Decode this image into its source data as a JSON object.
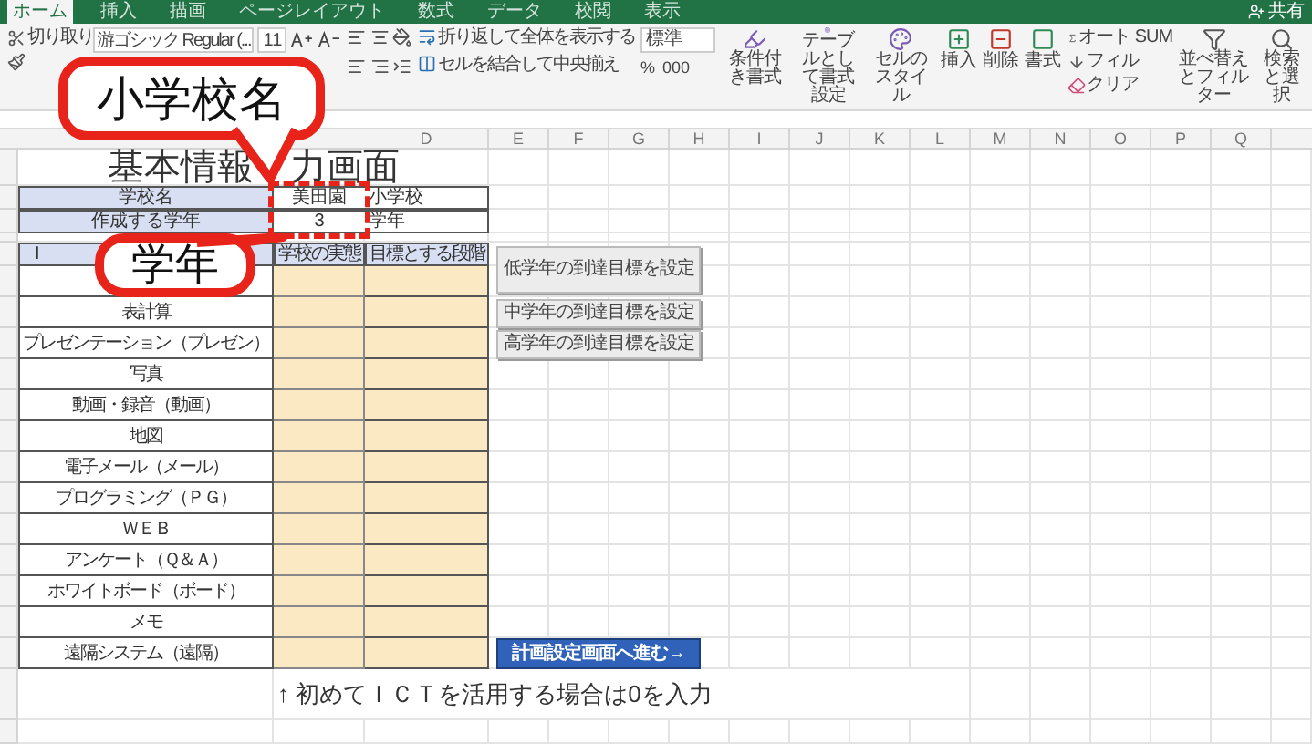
{
  "tabs": [
    {
      "label": "ホーム",
      "selected": true
    },
    {
      "label": "挿入",
      "selected": false
    },
    {
      "label": "描画",
      "selected": false
    },
    {
      "label": "ページレイアウト",
      "selected": false
    },
    {
      "label": "数式",
      "selected": false
    },
    {
      "label": "データ",
      "selected": false
    },
    {
      "label": "校閲",
      "selected": false
    },
    {
      "label": "表示",
      "selected": false
    }
  ],
  "share": "共有",
  "ribbon": {
    "cut": "切り取り",
    "font": "游ゴシック Regular (...",
    "size": "11",
    "wrap": "折り返して全体を表示する",
    "merge": "セルを結合して中央揃え",
    "number_format": "標準",
    "number_buttons": [
      "%",
      "000"
    ],
    "styles": [
      "条件付き書式",
      "テーブルとして書式設定",
      "セルのスタイル"
    ],
    "cells": [
      "挿入",
      "削除",
      "書式"
    ],
    "editing": [
      "オート SUM",
      "フィル",
      "クリア"
    ],
    "sort": "並べ替えとフィルター",
    "find": "検索と選択"
  },
  "columns": [
    "D",
    "E",
    "F",
    "G",
    "H",
    "I",
    "J",
    "K",
    "L",
    "M",
    "N",
    "O",
    "P",
    "Q"
  ],
  "sheet": {
    "title_parts": [
      "基本情報",
      "力画面"
    ],
    "info": [
      {
        "label": "学校名",
        "value": "美田園",
        "suffix": "小学校"
      },
      {
        "label": "作成する学年",
        "value": "3",
        "suffix": "学年"
      }
    ],
    "header": [
      "I",
      "学校の実態",
      "目標とする段階"
    ],
    "items": [
      {
        "label": "表計算"
      },
      {
        "label": "プレゼンテーション（プレゼン）"
      },
      {
        "label": "写真"
      },
      {
        "label": "動画・録音（動画）"
      },
      {
        "label": "地図"
      },
      {
        "label": "電子メール（メール）"
      },
      {
        "label": "プログラミング（ＰＧ）"
      },
      {
        "label": "ＷＥＢ"
      },
      {
        "label": "アンケート（Ｑ＆Ａ）"
      },
      {
        "label": "ホワイトボード（ボード）"
      },
      {
        "label": "メモ"
      },
      {
        "label": "遠隔システム（遠隔）"
      }
    ],
    "note": "↑ 初めてＩＣＴを活用する場合は0を入力"
  },
  "goal_buttons": [
    "低学年の到達目標を設定",
    "中学年の到達目標を設定",
    "高学年の到達目標を設定"
  ],
  "next_button": "計画設定画面へ進む→",
  "callouts": [
    "小学校名",
    "学年"
  ]
}
